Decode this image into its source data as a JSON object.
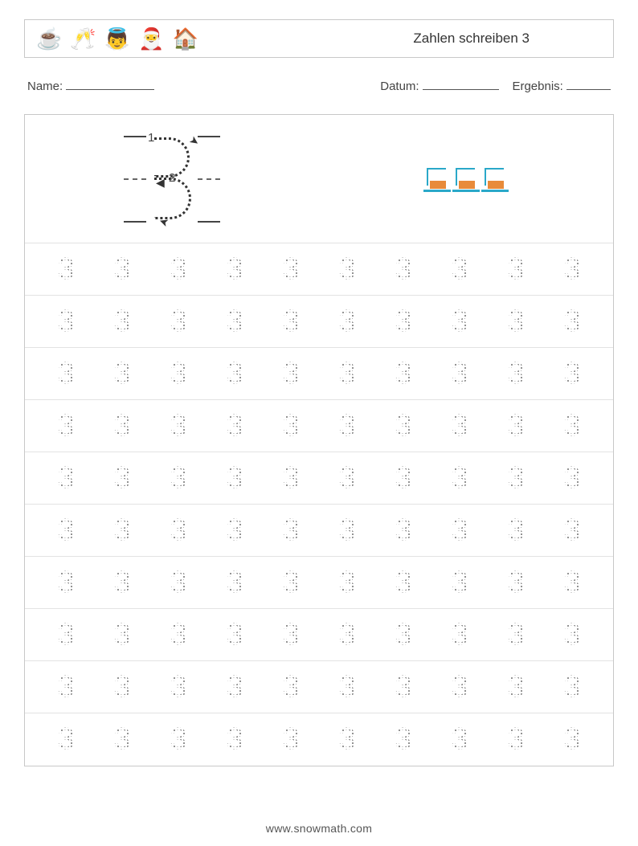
{
  "header": {
    "title": "Zahlen schreiben 3",
    "icons": [
      "cup-icon",
      "glasses-icon",
      "angel-icon",
      "hat-icon",
      "fireplace-icon"
    ]
  },
  "meta": {
    "name_label": "Name:",
    "date_label": "Datum:",
    "result_label": "Ergebnis:"
  },
  "demo": {
    "step1": "1",
    "step2": "2",
    "count": 3
  },
  "practice": {
    "digit": "3",
    "rows": 10,
    "cols": 10
  },
  "footer": {
    "url": "www.snowmath.com"
  }
}
